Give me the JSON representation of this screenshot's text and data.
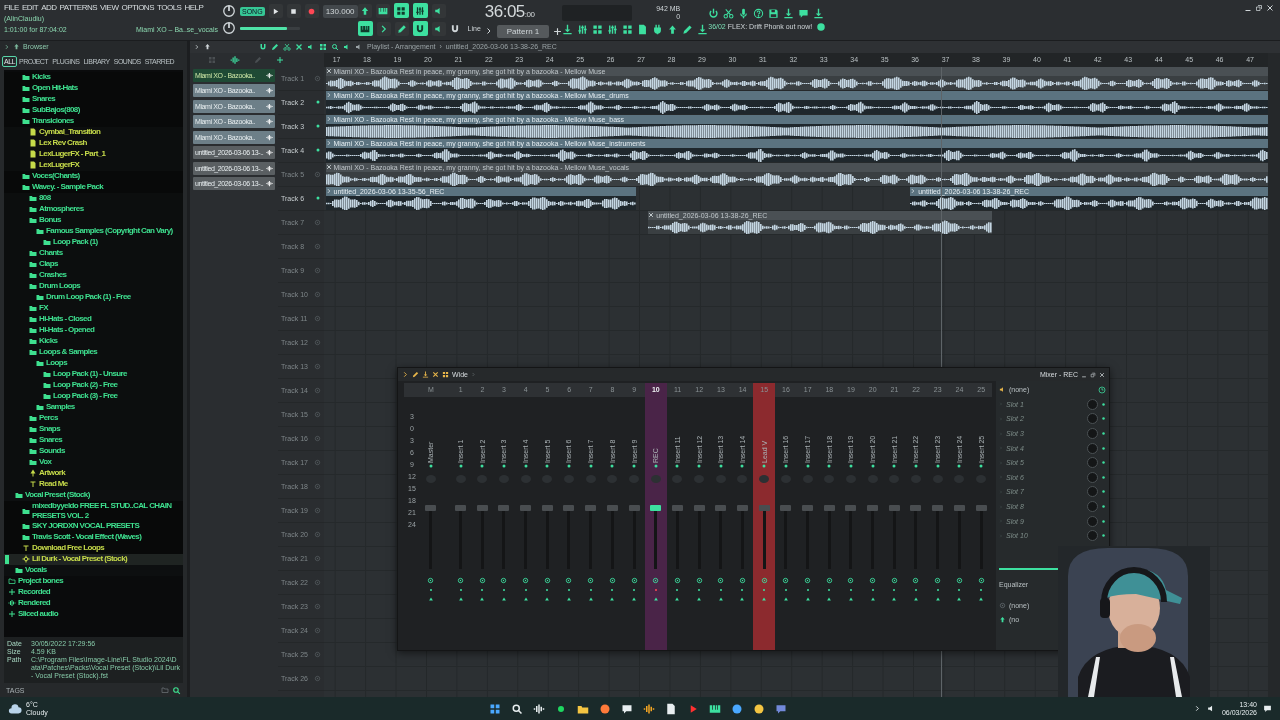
{
  "menu": [
    "FILE",
    "EDIT",
    "ADD",
    "PATTERNS",
    "VIEW",
    "OPTIONS",
    "TOOLS",
    "HELP"
  ],
  "hint": {
    "user": "(AlinClaudiu)",
    "time": "1:01:00 for 87:04:02",
    "file": "Miami XO – Ba..se_vocals"
  },
  "transport": {
    "mode": "SONG",
    "tempo": "130.000",
    "volume": {
      "level": 0.78
    },
    "time": "36:05",
    "time_small": ":00",
    "memory": "942 MB",
    "cpu": "0",
    "snap": "Line",
    "pattern": "Pattern 1"
  },
  "news": {
    "date": "36/02",
    "text": "FLEX: Drift Phonk out now!"
  },
  "browser": {
    "title": "Browser",
    "tabs": [
      {
        "label": "ALL",
        "selected": true
      },
      {
        "label": "PROJECT",
        "selected": false
      },
      {
        "label": "PLUGINS",
        "selected": false
      },
      {
        "label": "LIBRARY",
        "selected": false
      },
      {
        "label": "SOUNDS",
        "selected": false
      },
      {
        "label": "STARRED",
        "selected": false
      }
    ],
    "tree": [
      {
        "children": [
          {
            "children": [
              {
                "label": "Kicks",
                "kind": "folder",
                "selected": false
              },
              {
                "label": "Open Hit-Hats",
                "kind": "folder",
                "selected": false
              },
              {
                "label": "Snares",
                "kind": "folder",
                "selected": false
              },
              {
                "label": "SubBajos(808)",
                "kind": "folder",
                "selected": false
              },
              {
                "label": "Transiciones",
                "kind": "folder",
                "selected": false,
                "children": [
                  {
                    "label": "Cymbal_Transition",
                    "kind": "audio",
                    "selected": false
                  },
                  {
                    "label": "Lex Rev Crash",
                    "kind": "audio",
                    "selected": false
                  },
                  {
                    "label": "LexLugerFX - Part_1",
                    "kind": "audio",
                    "selected": false
                  },
                  {
                    "label": "LexLugerFX",
                    "kind": "audio",
                    "selected": false
                  }
                ]
              },
              {
                "label": "Voces(Chants)",
                "kind": "folder",
                "selected": false
              },
              {
                "label": "Wavey. - Sample Pack",
                "kind": "folder",
                "selected": false,
                "children": [
                  {
                    "label": "808",
                    "kind": "folder",
                    "selected": false
                  },
                  {
                    "label": "Atmospheres",
                    "kind": "folder",
                    "selected": false
                  },
                  {
                    "label": "Bonus",
                    "kind": "folder",
                    "selected": false,
                    "children": [
                      {
                        "label": "Famous Samples (Copyright Can Vary)",
                        "kind": "folder",
                        "selected": false,
                        "children": [
                          {
                            "label": "Loop Pack (1)",
                            "kind": "folder",
                            "selected": false
                          }
                        ]
                      }
                    ]
                  },
                  {
                    "label": "Chants",
                    "kind": "folder",
                    "selected": false
                  },
                  {
                    "label": "Claps",
                    "kind": "folder",
                    "selected": false
                  },
                  {
                    "label": "Crashes",
                    "kind": "folder",
                    "selected": false
                  },
                  {
                    "label": "Drum Loops",
                    "kind": "folder",
                    "selected": false,
                    "children": [
                      {
                        "label": "Drum Loop Pack (1) - Free",
                        "kind": "folder",
                        "selected": false
                      }
                    ]
                  },
                  {
                    "label": "FX",
                    "kind": "folder",
                    "selected": false
                  },
                  {
                    "label": "Hi-Hats - Closed",
                    "kind": "folder",
                    "selected": false
                  },
                  {
                    "label": "Hi-Hats - Opened",
                    "kind": "folder",
                    "selected": false
                  },
                  {
                    "label": "Kicks",
                    "kind": "folder",
                    "selected": false
                  },
                  {
                    "label": "Loops & Samples",
                    "kind": "folder",
                    "selected": false,
                    "children": [
                      {
                        "label": "Loops",
                        "kind": "folder",
                        "selected": false,
                        "children": [
                          {
                            "label": "Loop Pack (1) - Unsure",
                            "kind": "folder",
                            "selected": false
                          },
                          {
                            "label": "Loop Pack (2) - Free",
                            "kind": "folder",
                            "selected": false
                          },
                          {
                            "label": "Loop Pack (3) - Free",
                            "kind": "folder",
                            "selected": false
                          }
                        ]
                      },
                      {
                        "label": "Samples",
                        "kind": "folder",
                        "selected": false
                      }
                    ]
                  },
                  {
                    "label": "Percs",
                    "kind": "folder",
                    "selected": false
                  },
                  {
                    "label": "Snaps",
                    "kind": "folder",
                    "selected": false
                  },
                  {
                    "label": "Snares",
                    "kind": "folder",
                    "selected": false
                  },
                  {
                    "label": "Sounds",
                    "kind": "folder",
                    "selected": false
                  },
                  {
                    "label": "Vox",
                    "kind": "folder",
                    "selected": false
                  },
                  {
                    "label": "Artwork",
                    "selected": false
                  },
                  {
                    "label": "Read Me",
                    "kind": "text",
                    "selected": false
                  }
                ]
              }
            ]
          },
          {
            "label": "Vocal Preset (Stock)",
            "kind": "folder",
            "selected": false,
            "children": [
              {
                "label": "mixedbyyeldo FREE FL STUD..CAL CHAIN PRESETS VOL. 2",
                "kind": "folder",
                "selected": false
              },
              {
                "label": "SKY JORDXN VOCAL PRESETS",
                "kind": "folder",
                "selected": false
              },
              {
                "label": "Travis Scott - Vocal Effect (Waves)",
                "kind": "folder",
                "selected": false
              },
              {
                "label": "Download Free Loops",
                "kind": "text",
                "selected": false
              },
              {
                "label": "Lil Durk - Vocal Preset (Stock)",
                "kind": "preset",
                "selected": true
              }
            ]
          },
          {
            "label": "Vocals",
            "kind": "folder",
            "selected": false
          }
        ]
      },
      {
        "label": "Project bones",
        "kind": "project",
        "selected": false
      },
      {
        "label": "Recorded",
        "kind": "audio-folder",
        "selected": false
      },
      {
        "label": "Rendered",
        "kind": "render",
        "selected": false
      },
      {
        "label": "Sliced audio",
        "kind": "audio-folder",
        "selected": false
      }
    ],
    "info": [
      {
        "label": "Date",
        "value": "30/05/2022 17:29:56"
      },
      {
        "label": "Size",
        "value": "4.59 KB"
      },
      {
        "label": "Path",
        "value": "C:\\Program Files\\Image-Line\\FL Studio 2024\\Data\\Patches\\Packs\\Vocal Preset (Stock)\\Lil Durk - Vocal Preset (Stock).fst"
      }
    ],
    "tags_label": "TAGS"
  },
  "playlist": {
    "title": "Playlist - Arrangement",
    "separator": "›",
    "path": "untitled_2026-03-06 13-38-26_REC",
    "clips": [
      {
        "label": "Miami XO - Bazooka..",
        "selected": true
      },
      {
        "label": "Miami XO - Bazooka..",
        "selected": false
      },
      {
        "label": "Miami XO - Bazooka..",
        "selected": false
      },
      {
        "label": "Miami XO - Bazooka..",
        "selected": false
      },
      {
        "label": "Miami XO - Bazooka..",
        "selected": false
      },
      {
        "label": "untitled_2026-03-06 13-..",
        "selected": false
      },
      {
        "label": "untitled_2026-03-06 13-..",
        "selected": false
      },
      {
        "label": "untitled_2026-03-06 13-..",
        "selected": false
      }
    ],
    "ruler": [
      "17",
      "18",
      "19",
      "20",
      "21",
      "22",
      "23",
      "24",
      "25",
      "26",
      "27",
      "28",
      "29",
      "30",
      "31",
      "32",
      "33",
      "34",
      "35",
      "36",
      "37",
      "38",
      "39",
      "40",
      "41",
      "42",
      "43",
      "44",
      "45",
      "46",
      "47"
    ],
    "tracks": [
      {
        "name": "Track 1",
        "dimmed": true,
        "clips": [
          {
            "title": "Miami XO - Bazooka Rest in peace, my granny, she got hit by a bazooka - Mellow Muse",
            "muted": true
          }
        ]
      },
      {
        "name": "Track 2",
        "dimmed": false,
        "clips": [
          {
            "title": "Miami XO - Bazooka Rest in peace, my granny, she got hit by a bazooka - Mellow Muse_drums",
            "muted": false
          }
        ]
      },
      {
        "name": "Track 3",
        "dimmed": false,
        "clips": [
          {
            "title": "Miami XO - Bazooka Rest in peace, my granny, she got hit by a bazooka - Mellow Muse_bass",
            "muted": false
          }
        ]
      },
      {
        "name": "Track 4",
        "dimmed": false,
        "clips": [
          {
            "title": "Miami XO - Bazooka Rest in peace, my granny, she got hit by a bazooka - Mellow Muse_instruments",
            "muted": false
          }
        ]
      },
      {
        "name": "Track 5",
        "dimmed": true,
        "clips": [
          {
            "title": "Miami XO - Bazooka Rest in peace, my granny, she got hit by a bazooka - Mellow Muse_vocals",
            "muted": true
          }
        ]
      },
      {
        "name": "Track 6",
        "dimmed": false,
        "clips": [
          {
            "title": "untitled_2026-03-06 13-35-56_REC",
            "muted": false
          },
          {
            "title": "untitled_2026-03-06 13-38-26_REC",
            "muted": false
          }
        ]
      },
      {
        "name": "Track 7",
        "dimmed": true,
        "clips": [
          {
            "title": "untitled_2026-03-06 13-38-26_REC",
            "muted": true
          }
        ]
      },
      {
        "name": "Track 8",
        "dimmed": true
      },
      {
        "name": "Track 9",
        "dimmed": true
      },
      {
        "name": "Track 10",
        "dimmed": true
      },
      {
        "name": "Track 11",
        "dimmed": true
      },
      {
        "name": "Track 12",
        "dimmed": true
      },
      {
        "name": "Track 13",
        "dimmed": true
      },
      {
        "name": "Track 14",
        "dimmed": true
      },
      {
        "name": "Track 15",
        "dimmed": true
      },
      {
        "name": "Track 16",
        "dimmed": true
      },
      {
        "name": "Track 17",
        "dimmed": true
      },
      {
        "name": "Track 18",
        "dimmed": true
      },
      {
        "name": "Track 19",
        "dimmed": true
      },
      {
        "name": "Track 20",
        "dimmed": true
      },
      {
        "name": "Track 21",
        "dimmed": true
      },
      {
        "name": "Track 22",
        "dimmed": true
      },
      {
        "name": "Track 23",
        "dimmed": true
      },
      {
        "name": "Track 24",
        "dimmed": true
      },
      {
        "name": "Track 25",
        "dimmed": true
      },
      {
        "name": "Track 26",
        "dimmed": true
      }
    ]
  },
  "mixer": {
    "mode": "Wide",
    "title": "Mixer - REC",
    "scale": [
      "3",
      "0",
      "3",
      "6",
      "9",
      "12",
      "15",
      "18",
      "21",
      "24"
    ],
    "strips": [
      {
        "number": "M",
        "name": "Master",
        "selected": false
      },
      {
        "number": "1",
        "name": "Insert 1",
        "selected": false
      },
      {
        "number": "2",
        "name": "Insert 2",
        "selected": false
      },
      {
        "number": "3",
        "name": "Insert 3",
        "selected": false
      },
      {
        "number": "4",
        "name": "Insert 4",
        "selected": false
      },
      {
        "number": "5",
        "name": "Insert 5",
        "selected": false
      },
      {
        "number": "6",
        "name": "Insert 6",
        "selected": false
      },
      {
        "number": "7",
        "name": "Insert 7",
        "selected": false
      },
      {
        "number": "8",
        "name": "Insert 8",
        "selected": false
      },
      {
        "number": "9",
        "name": "Insert 9",
        "selected": false
      },
      {
        "number": "10",
        "name": "REC",
        "selected": true,
        "color": "#4a2448"
      },
      {
        "number": "11",
        "name": "Insert 11",
        "selected": false
      },
      {
        "number": "12",
        "name": "Insert 12",
        "selected": false
      },
      {
        "number": "13",
        "name": "Insert 13",
        "selected": false
      },
      {
        "number": "14",
        "name": "Insert 14",
        "selected": false
      },
      {
        "number": "15",
        "name": "Lead V",
        "selected": false,
        "color": "#8c2a2e"
      },
      {
        "number": "16",
        "name": "Insert 16",
        "selected": false
      },
      {
        "number": "17",
        "name": "Insert 17",
        "selected": false
      },
      {
        "number": "18",
        "name": "Insert 18",
        "selected": false
      },
      {
        "number": "19",
        "name": "Insert 19",
        "selected": false
      },
      {
        "number": "20",
        "name": "Insert 20",
        "selected": false
      },
      {
        "number": "21",
        "name": "Insert 21",
        "selected": false
      },
      {
        "number": "22",
        "name": "Insert 22",
        "selected": false
      },
      {
        "number": "23",
        "name": "Insert 23",
        "selected": false
      },
      {
        "number": "24",
        "name": "Insert 24",
        "selected": false
      },
      {
        "number": "25",
        "name": "Insert 25",
        "selected": false
      }
    ],
    "input": "(none)",
    "slots": [
      "Slot 1",
      "Slot 2",
      "Slot 3",
      "Slot 4",
      "Slot 5",
      "Slot 6",
      "Slot 7",
      "Slot 8",
      "Slot 9",
      "Slot 10"
    ],
    "eq": "Equalizer",
    "eq_value": "(none)",
    "output": "(no"
  },
  "taskbar": {
    "temperature": "6°C",
    "condition": "Cloudy",
    "time": "13:40",
    "date": "06/03/2026"
  }
}
